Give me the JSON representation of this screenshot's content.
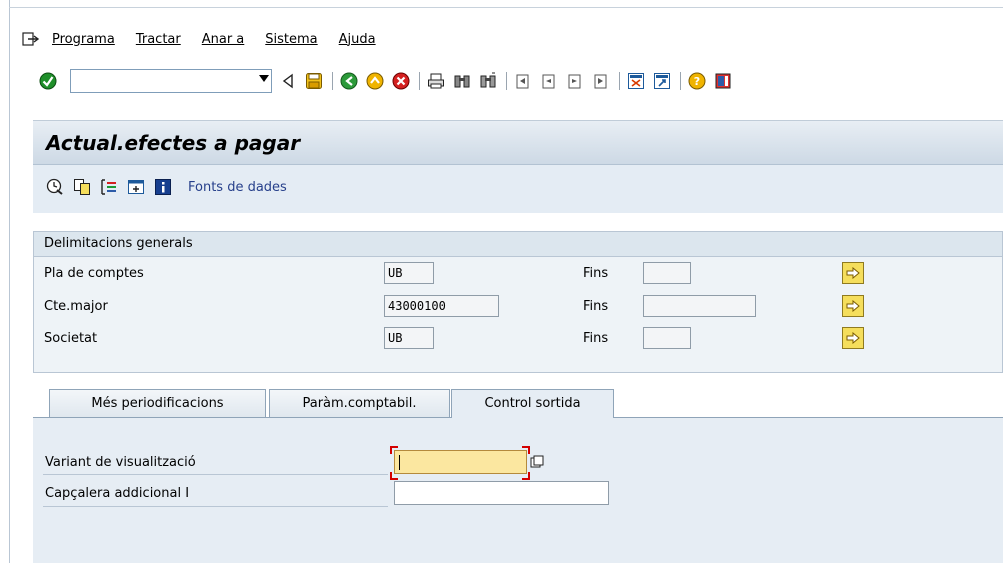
{
  "menu": {
    "items": [
      {
        "label": "Programa"
      },
      {
        "label": "Tractar"
      },
      {
        "label": "Anar a"
      },
      {
        "label": "Sistema"
      },
      {
        "label": "Ajuda"
      }
    ]
  },
  "toolbar": {
    "command_field": {
      "value": "",
      "placeholder": ""
    }
  },
  "screen": {
    "title": "Actual.efectes a pagar",
    "fonts_label": "Fonts de dades"
  },
  "delimitations": {
    "header": "Delimitacions generals",
    "to_label": "Fins",
    "rows": [
      {
        "label": "Pla de comptes",
        "from": "UB",
        "to": ""
      },
      {
        "label": "Cte.major",
        "from": "43000100",
        "to": ""
      },
      {
        "label": "Societat",
        "from": "UB",
        "to": ""
      }
    ]
  },
  "tabs": [
    {
      "label": "Més periodificacions",
      "active": false
    },
    {
      "label": "Paràm.comptabil.",
      "active": false
    },
    {
      "label": "Control sortida",
      "active": true
    }
  ],
  "output_control": {
    "variant_label": "Variant de visualització",
    "variant_value": "",
    "header_label": "Capçalera addicional I",
    "header_value": ""
  },
  "colors": {
    "accent_yellow": "#f5de5c",
    "focus_field": "#fbe7a0",
    "panel_bg": "#e6edf4",
    "link_blue": "#27408b"
  }
}
